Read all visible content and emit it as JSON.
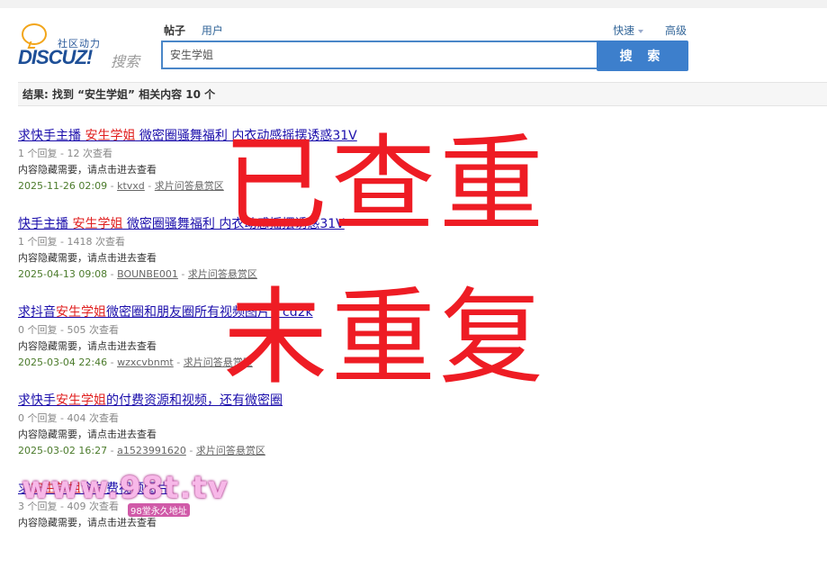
{
  "header": {
    "logo_tagline": "社区动力",
    "logo_main": "DISCUZ",
    "logo_bang": "!",
    "logo_sub": "搜索",
    "tabs": [
      "帖子",
      "用户"
    ],
    "quick_label": "快速",
    "advanced_label": "高级",
    "search_value": "安生学姐",
    "search_button": "搜 索"
  },
  "result_summary": "结果: 找到 “安生学姐” 相关内容 10 个",
  "results": [
    {
      "title_pre": "求快手主播 ",
      "title_hl": "安生学姐",
      "title_post": " 微密圈骚舞福利 内衣动感摇摆诱惑31V",
      "meta": "1 个回复 - 12 次查看",
      "note": "内容隐藏需要，请点击进去查看",
      "date": "2025-11-26 02:09",
      "author": "ktvxd",
      "forum": "求片问答悬赏区"
    },
    {
      "title_pre": "快手主播 ",
      "title_hl": "安生学姐",
      "title_post": " 微密圈骚舞福利 内衣动感摇摆诱惑31V",
      "meta": "1 个回复 - 1418 次查看",
      "note": "内容隐藏需要，请点击进去查看",
      "date": "2025-04-13 09:08",
      "author": "BOUNBE001",
      "forum": "求片问答悬赏区"
    },
    {
      "title_pre": "求抖音",
      "title_hl": "安生学姐",
      "title_post": "微密圈和朋友圈所有视频图片，cd2k",
      "meta": "0 个回复 - 505 次查看",
      "note": "内容隐藏需要，请点击进去查看",
      "date": "2025-03-04 22:46",
      "author": "wzxcvbnmt",
      "forum": "求片问答悬赏区"
    },
    {
      "title_pre": "求快手",
      "title_hl": "安生学姐",
      "title_post": "的付费资源和视频，还有微密圈",
      "meta": "0 个回复 - 404 次查看",
      "note": "内容隐藏需要，请点击进去查看",
      "date": "2025-03-02 16:27",
      "author": "a1523991620",
      "forum": "求片问答悬赏区"
    },
    {
      "title_pre": "求",
      "title_hl": "安生学姐",
      "title_post": "含付费视频图片",
      "meta": "3 个回复 - 409 次查看",
      "note": "内容隐藏需要，请点击进去查看",
      "date": "",
      "author": "",
      "forum": ""
    }
  ],
  "stamp": {
    "line1": "已查重",
    "line2": "未重复"
  },
  "watermark": {
    "main": "www.98t.tv",
    "sub": "98堂永久地址"
  }
}
